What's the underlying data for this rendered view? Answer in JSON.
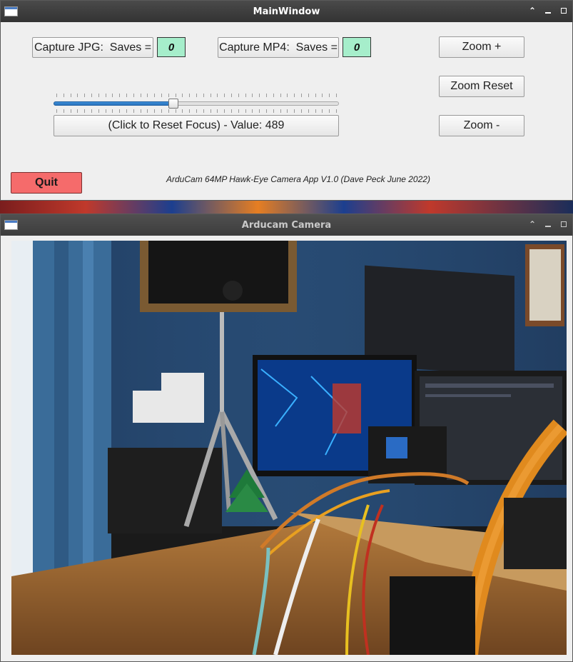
{
  "main_window": {
    "title": "MainWindow",
    "capture_jpg": {
      "label": "Capture JPG:  Saves =",
      "count": "0"
    },
    "capture_mp4": {
      "label": "Capture MP4:  Saves =",
      "count": "0"
    },
    "zoom_in_label": "Zoom +",
    "zoom_reset_label": "Zoom Reset",
    "zoom_out_label": "Zoom -",
    "focus": {
      "reset_label": "(Click to Reset Focus) - Value: 489",
      "slider_level_fraction": 0.42
    },
    "quit_label": "Quit",
    "credit": "ArduCam 64MP Hawk-Eye Camera App V1.0 (Dave Peck June 2022)"
  },
  "camera_window": {
    "title": "Arducam Camera",
    "preview_description_icon": "camera-feed"
  },
  "colors": {
    "counter_bg": "#a6eecb",
    "quit_bg": "#f56b6b",
    "slider_fill": "#2a73bd"
  }
}
